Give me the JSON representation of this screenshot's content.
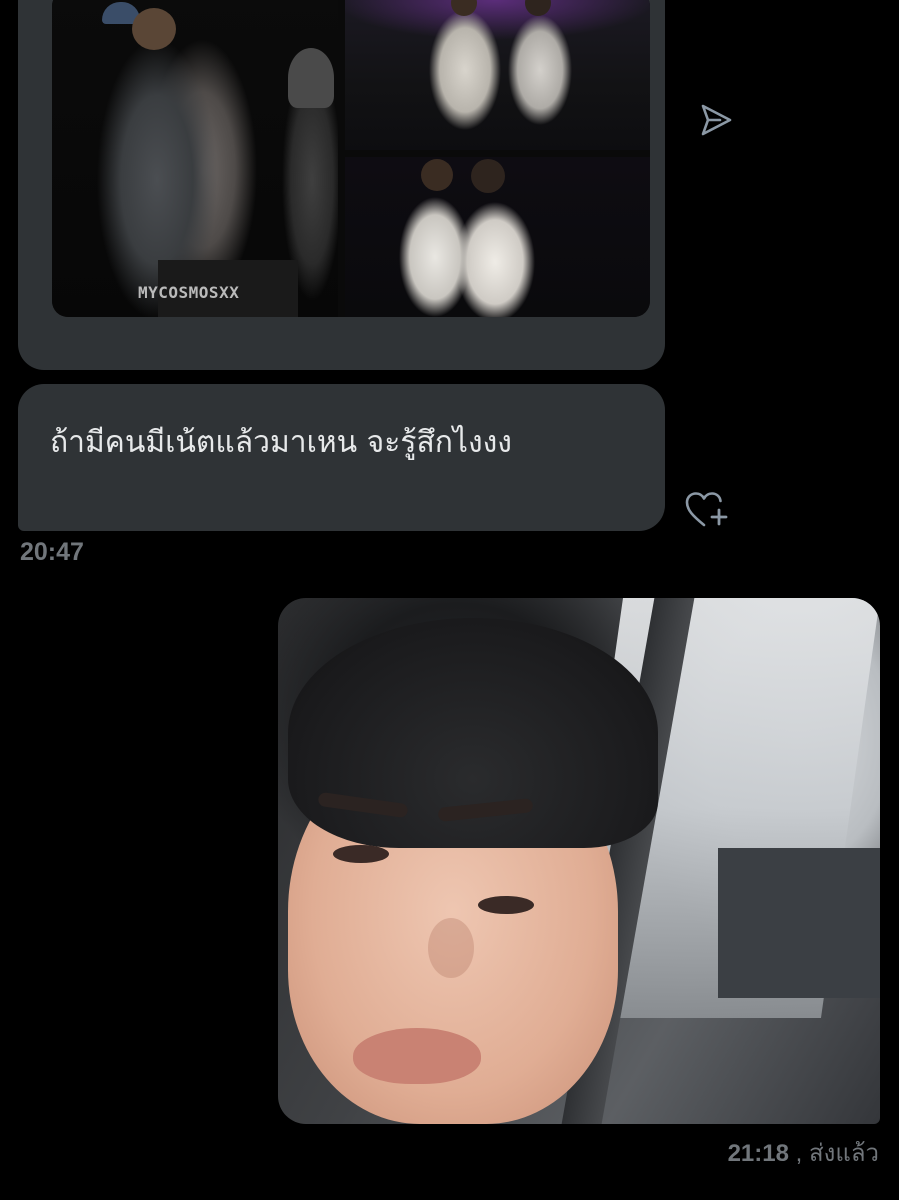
{
  "conversation": {
    "incoming_media": {
      "watermark": "MYCOSMOSXX"
    },
    "incoming_text": {
      "message": "ถ้ามีคนมีเน้ตแล้วมาเหน จะรู้สึกไงงง",
      "time": "20:47"
    },
    "outgoing_media": {
      "time": "21:18",
      "status": ", ส่งแล้ว"
    },
    "icons": {
      "share": "share-icon",
      "react": "add-reaction-icon"
    },
    "colors": {
      "background": "#000000",
      "bubble_incoming": "#2f3336",
      "text_primary": "#e7e9ea",
      "text_secondary": "#71767b"
    }
  }
}
